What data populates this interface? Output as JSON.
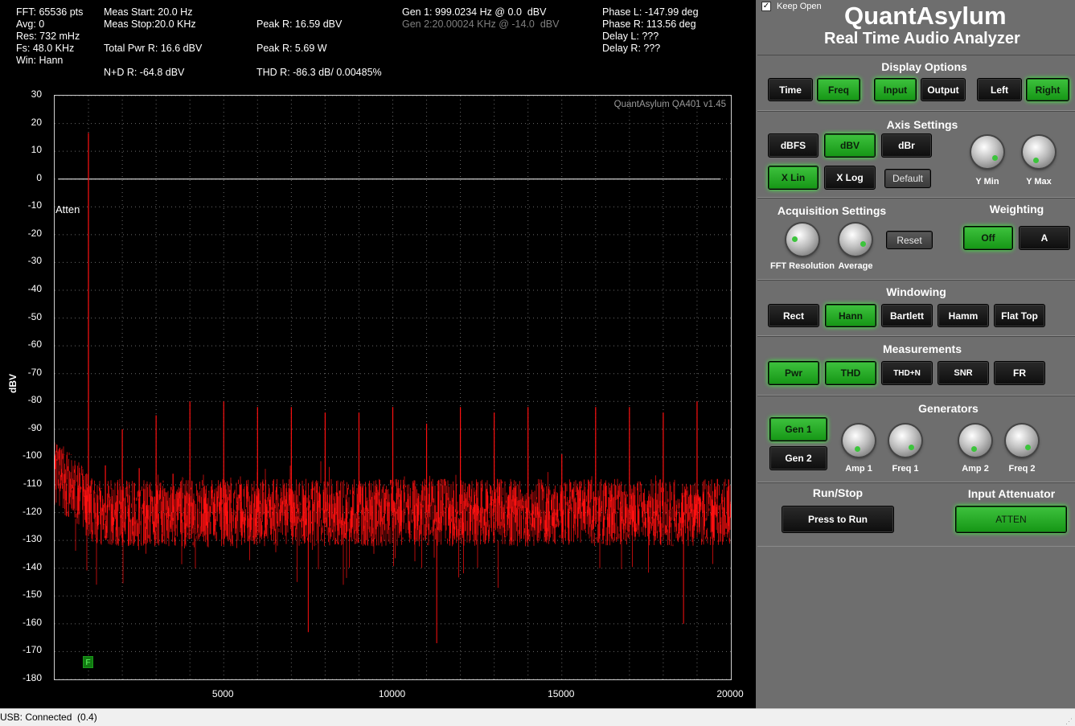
{
  "header": {
    "fft": "FFT: 65536 pts",
    "avg": "Avg: 0",
    "res": "Res: 732 mHz",
    "fs": "Fs: 48.0 KHz",
    "win": "Win: Hann",
    "meas_start": "Meas Start: 20.0 Hz",
    "meas_stop": "Meas Stop:20.0 KHz",
    "total_pwr": "Total Pwr R: 16.6 dBV",
    "nd": "N+D R: -64.8 dBV",
    "peak_dbv": "Peak R: 16.59 dBV",
    "peak_w": "Peak R: 5.69 W",
    "thd": "THD R: -86.3 dB/ 0.00485%",
    "gen1": "Gen 1: 999.0234 Hz @ 0.0  dBV",
    "gen2": "Gen 2:20.00024 KHz @ -14.0  dBV",
    "phase_l": "Phase L: -147.99 deg",
    "phase_r": "Phase R: 113.56 deg",
    "delay_l": "Delay L: ???",
    "delay_r": "Delay R: ???"
  },
  "plot": {
    "watermark": "QuantAsylum QA401 v1.45",
    "atten_label": "Atten",
    "ylabel": "dBV",
    "marker": "F",
    "trace_color": "#ff1010"
  },
  "chart_data": {
    "type": "line",
    "title": "",
    "xlabel": "",
    "ylabel": "dBV",
    "xlim": [
      0,
      20000
    ],
    "ylim": [
      -180,
      30
    ],
    "xticks": [
      5000,
      10000,
      15000,
      20000
    ],
    "yticks": [
      30,
      20,
      10,
      0,
      -10,
      -20,
      -30,
      -40,
      -50,
      -60,
      -70,
      -80,
      -90,
      -100,
      -110,
      -120,
      -130,
      -140,
      -150,
      -160,
      -170,
      -180
    ],
    "grid": true,
    "reference_line": 0,
    "noise_floor": {
      "center": -120,
      "range": [
        -135,
        -108
      ]
    },
    "spurs": [
      {
        "x": 999,
        "y": 16.59
      },
      {
        "x": 1500,
        "y": -103
      },
      {
        "x": 2000,
        "y": -90
      },
      {
        "x": 2500,
        "y": -104
      },
      {
        "x": 3000,
        "y": -85
      },
      {
        "x": 3500,
        "y": -106
      },
      {
        "x": 4000,
        "y": -80
      },
      {
        "x": 5000,
        "y": -80
      },
      {
        "x": 6000,
        "y": -82
      },
      {
        "x": 7000,
        "y": -82
      },
      {
        "x": 8000,
        "y": -84
      },
      {
        "x": 9000,
        "y": -84
      },
      {
        "x": 10000,
        "y": -82
      },
      {
        "x": 11000,
        "y": -88
      },
      {
        "x": 12000,
        "y": -82
      },
      {
        "x": 13000,
        "y": -84
      },
      {
        "x": 14000,
        "y": -82
      },
      {
        "x": 15000,
        "y": -99
      },
      {
        "x": 16000,
        "y": -82
      },
      {
        "x": 17000,
        "y": -82
      },
      {
        "x": 18000,
        "y": -84
      },
      {
        "x": 19000,
        "y": -80
      }
    ],
    "dips": [
      {
        "x": 7500,
        "y": -163
      },
      {
        "x": 11300,
        "y": -167
      },
      {
        "x": 18600,
        "y": -160
      }
    ]
  },
  "panel": {
    "keep_open": "Keep Open",
    "brand": "QuantAsylum",
    "subtitle": "Real Time Audio Analyzer",
    "display_options": {
      "title": "Display Options",
      "time": "Time",
      "freq": "Freq",
      "input": "Input",
      "output": "Output",
      "left": "Left",
      "right": "Right"
    },
    "axis_settings": {
      "title": "Axis Settings",
      "dbfs": "dBFS",
      "dbv": "dBV",
      "dbr": "dBr",
      "xlin": "X Lin",
      "xlog": "X Log",
      "default": "Default",
      "ymin": "Y Min",
      "ymax": "Y Max"
    },
    "acquisition": {
      "title": "Acquisition Settings",
      "fft_res": "FFT Resolution",
      "average": "Average",
      "reset": "Reset"
    },
    "weighting": {
      "title": "Weighting",
      "off": "Off",
      "a": "A"
    },
    "windowing": {
      "title": "Windowing",
      "rect": "Rect",
      "hann": "Hann",
      "bartlett": "Bartlett",
      "hamm": "Hamm",
      "flattop": "Flat Top"
    },
    "measurements": {
      "title": "Measurements",
      "pwr": "Pwr",
      "thd": "THD",
      "thdn": "THD+N",
      "snr": "SNR",
      "fr": "FR"
    },
    "generators": {
      "title": "Generators",
      "gen1": "Gen 1",
      "gen2": "Gen 2",
      "amp1": "Amp 1",
      "freq1": "Freq 1",
      "amp2": "Amp 2",
      "freq2": "Freq 2"
    },
    "run_stop": {
      "title": "Run/Stop",
      "press_to_run": "Press to Run"
    },
    "input_atten": {
      "title": "Input Attenuator",
      "atten": "ATTEN"
    }
  },
  "status": {
    "text": "USB: Connected  (0.4)"
  }
}
